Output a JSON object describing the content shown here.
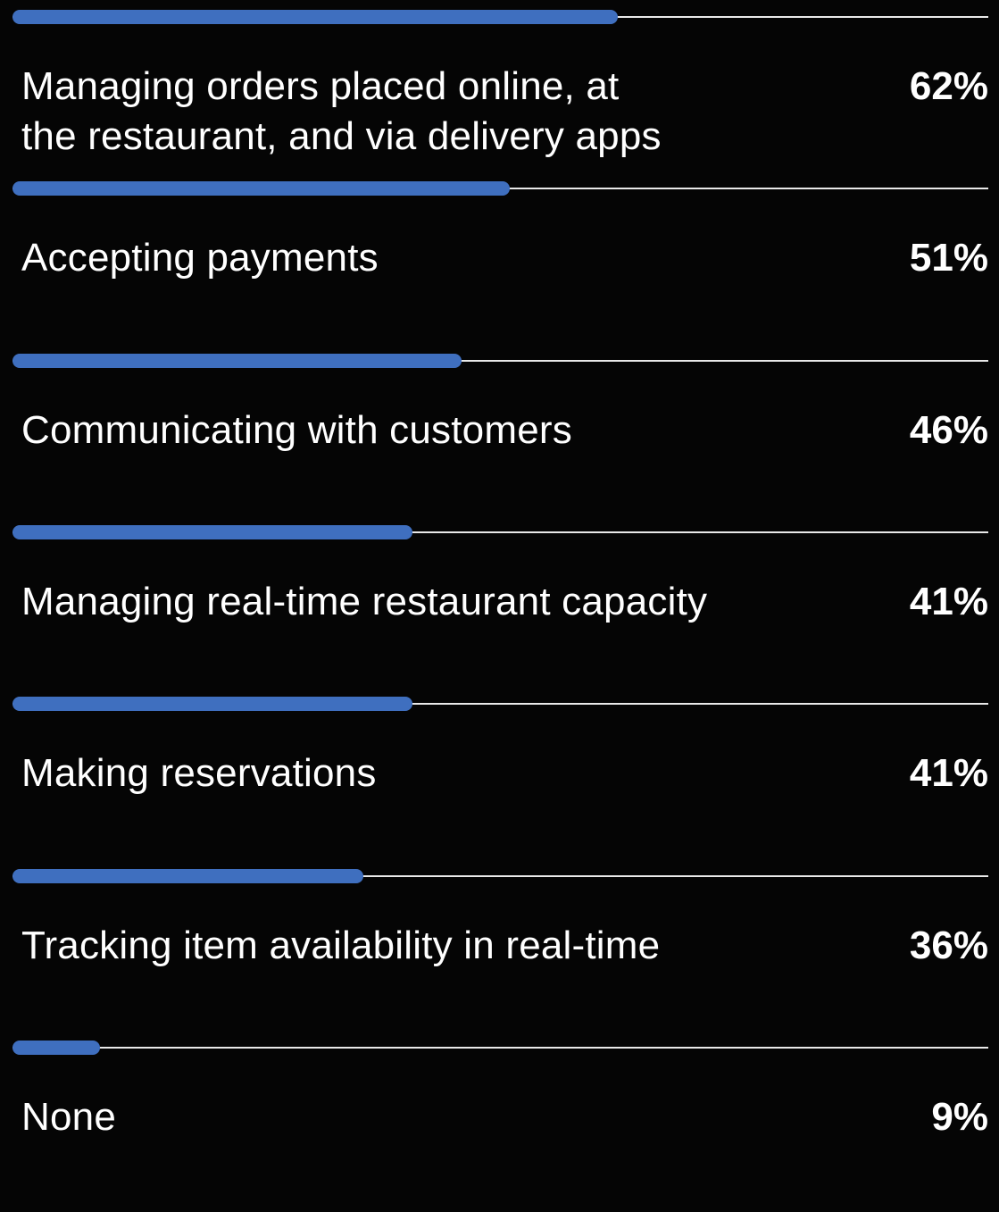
{
  "colors": {
    "background": "#050505",
    "bar": "#3f6fbf",
    "track": "#e9e9e9",
    "text": "#ffffff"
  },
  "chart_data": {
    "type": "bar",
    "orientation": "horizontal",
    "categories": [
      "Managing orders placed online, at the restaurant, and via delivery apps",
      "Accepting payments",
      "Communicating with customers",
      "Managing real-time restaurant capacity",
      "Making reservations",
      "Tracking item availability in real-time",
      "None"
    ],
    "values": [
      62,
      51,
      46,
      41,
      41,
      36,
      9
    ],
    "value_labels": [
      "62%",
      "51%",
      "46%",
      "41%",
      "41%",
      "36%",
      "9%"
    ],
    "xlim": [
      0,
      100
    ],
    "grid": false,
    "legend": "none"
  }
}
